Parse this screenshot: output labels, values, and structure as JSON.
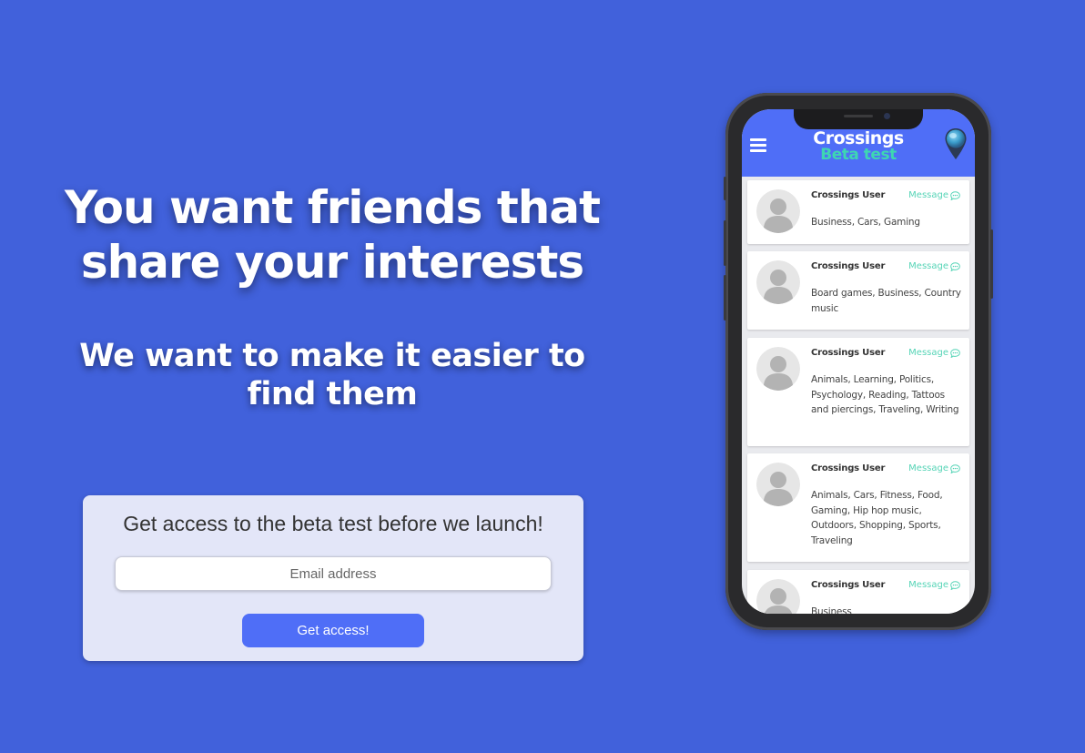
{
  "hero": {
    "title": "You want friends that share your interests",
    "subtitle": "We want to make it easier to find them"
  },
  "signup": {
    "heading": "Get access to the beta test before we launch!",
    "email_placeholder": "Email address",
    "email_value": "",
    "button_label": "Get access!"
  },
  "app": {
    "title": "Crossings",
    "subtitle": "Beta test",
    "menu_icon": "hamburger-menu-icon",
    "location_icon": "map-pin-icon",
    "header_color": "#4f6ef7",
    "accent_color": "#3ed6b2",
    "users": [
      {
        "name": "Crossings User",
        "message_label": "Message",
        "interests": "Business, Cars, Gaming"
      },
      {
        "name": "Crossings User",
        "message_label": "Message",
        "interests": "Board games, Business, Country music"
      },
      {
        "name": "Crossings User",
        "message_label": "Message",
        "interests": "Animals, Learning, Politics, Psychology, Reading, Tattoos and piercings, Traveling, Writing"
      },
      {
        "name": "Crossings User",
        "message_label": "Message",
        "interests": "Animals, Cars, Fitness, Food, Gaming, Hip hop music, Outdoors, Shopping, Sports, Traveling"
      },
      {
        "name": "Crossings User",
        "message_label": "Message",
        "interests": "Business"
      }
    ]
  },
  "colors": {
    "background": "#4161db",
    "card_background": "#e3e6f8",
    "button": "#4f6ef7"
  }
}
